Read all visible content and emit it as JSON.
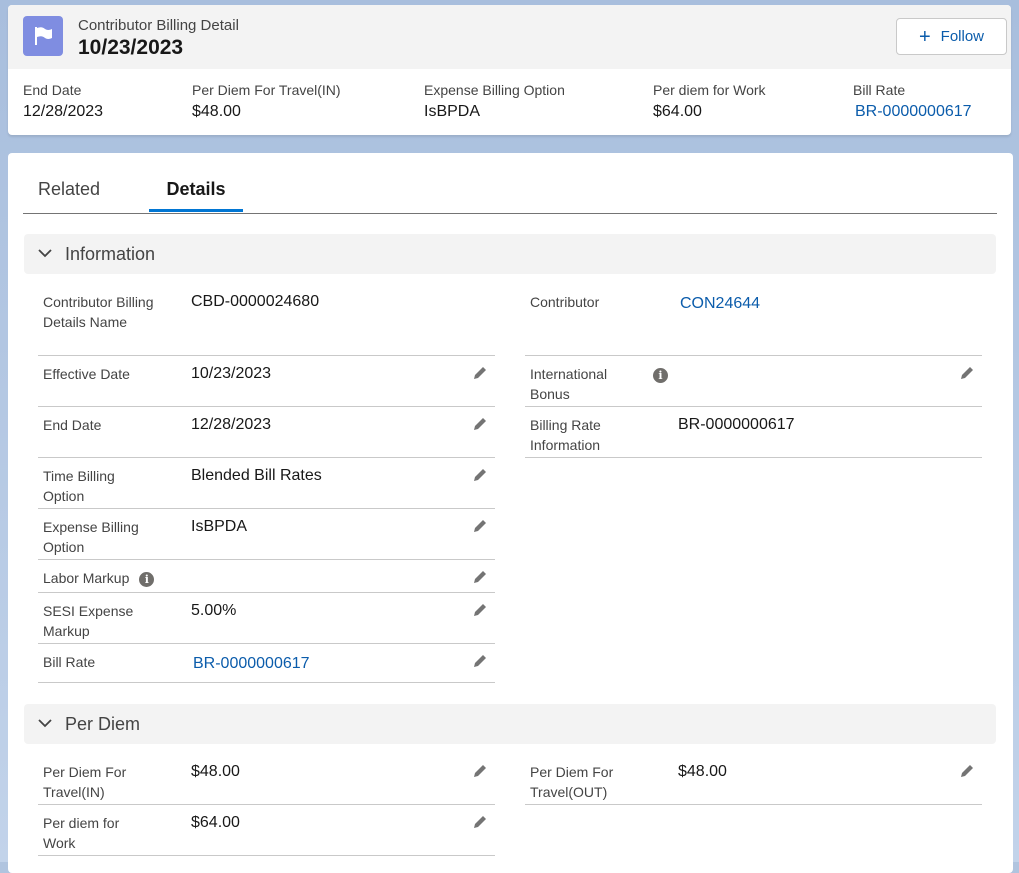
{
  "header": {
    "object_label": "Contributor Billing Detail",
    "record_title": "10/23/2023",
    "follow_label": "Follow",
    "highlights": [
      {
        "label": "End Date",
        "value": "12/28/2023"
      },
      {
        "label": "Per Diem For Travel(IN)",
        "value": "$48.00"
      },
      {
        "label": "Expense Billing Option",
        "value": "IsBPDA"
      },
      {
        "label": "Per diem for Work",
        "value": "$64.00"
      },
      {
        "label": "Bill Rate",
        "value": "BR-0000000617"
      }
    ]
  },
  "tabs": {
    "related": "Related",
    "details": "Details"
  },
  "sections": {
    "information": {
      "title": "Information",
      "left": [
        {
          "label": "Contributor Billing Details Name",
          "value": "CBD-0000024680"
        },
        {
          "label": "Effective Date",
          "value": "10/23/2023"
        },
        {
          "label": "End Date",
          "value": "12/28/2023"
        },
        {
          "label": "Time Billing Option",
          "value": "Blended Bill Rates"
        },
        {
          "label": "Expense Billing Option",
          "value": "IsBPDA"
        },
        {
          "label": "Labor Markup",
          "value": ""
        },
        {
          "label": "SESI Expense Markup",
          "value": "5.00%"
        },
        {
          "label": "Bill Rate",
          "value": "BR-0000000617"
        }
      ],
      "right": [
        {
          "label": "Contributor",
          "value": "CON24644"
        },
        {
          "label": "International Bonus",
          "value": ""
        },
        {
          "label": "Billing Rate Information",
          "value": "BR-0000000617"
        }
      ]
    },
    "per_diem": {
      "title": "Per Diem",
      "left": [
        {
          "label": "Per Diem For Travel(IN)",
          "value": "$48.00"
        },
        {
          "label": "Per diem for Work",
          "value": "$64.00"
        }
      ],
      "right": [
        {
          "label": "Per Diem For Travel(OUT)",
          "value": "$48.00"
        }
      ]
    }
  },
  "icons": {
    "info": "i",
    "plus": "+"
  },
  "colors": {
    "link": "#0b5cab",
    "record_icon": "#7f8de1",
    "tab_active": "#0176d3"
  }
}
